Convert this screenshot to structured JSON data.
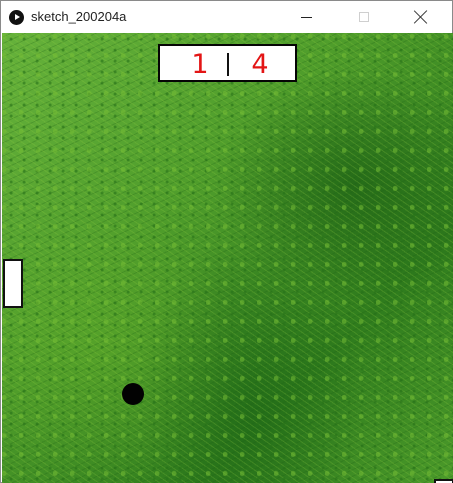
{
  "window": {
    "title": "sketch_200204a"
  },
  "scoreboard": {
    "left_score": "1",
    "right_score": "4"
  }
}
